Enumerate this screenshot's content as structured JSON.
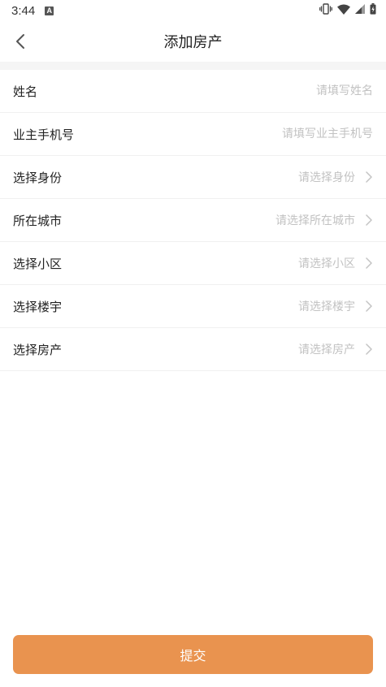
{
  "status_bar": {
    "time": "3:44",
    "notification_letter": "A",
    "icons": [
      "vibrate-icon",
      "wifi-icon",
      "signal-icon",
      "battery-icon"
    ]
  },
  "header": {
    "title": "添加房产",
    "back_icon": "chevron-left-icon"
  },
  "form": {
    "name": {
      "label": "姓名",
      "placeholder": "请填写姓名",
      "value": ""
    },
    "owner_phone": {
      "label": "业主手机号",
      "placeholder": "请填写业主手机号",
      "value": ""
    },
    "identity": {
      "label": "选择身份",
      "placeholder": "请选择身份"
    },
    "city": {
      "label": "所在城市",
      "placeholder": "请选择所在城市"
    },
    "community": {
      "label": "选择小区",
      "placeholder": "请选择小区"
    },
    "building": {
      "label": "选择楼宇",
      "placeholder": "请选择楼宇"
    },
    "property": {
      "label": "选择房产",
      "placeholder": "请选择房产"
    }
  },
  "submit": {
    "label": "提交"
  },
  "colors": {
    "accent": "#e9934f",
    "placeholder": "#c2c2c2",
    "divider": "#f0f0f0",
    "section_bg": "#f5f5f5"
  }
}
